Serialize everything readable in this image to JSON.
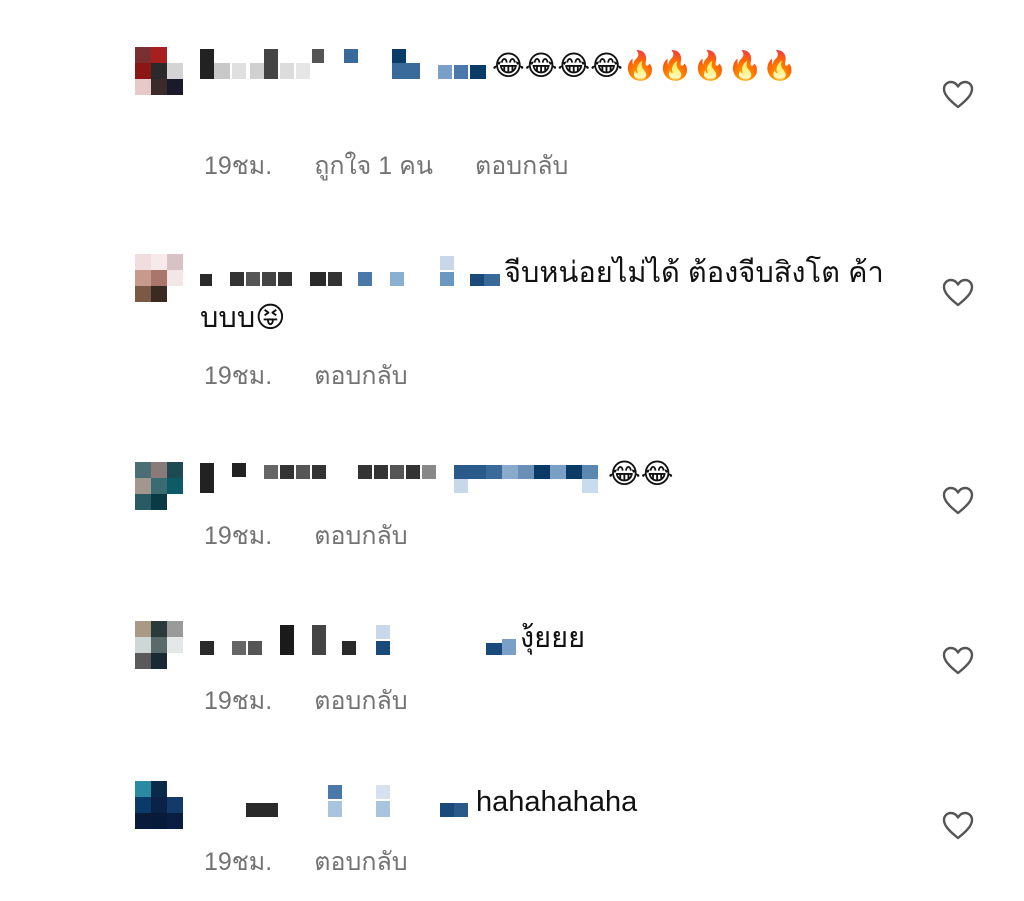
{
  "comments": [
    {
      "text": "😂😂😂😂🔥🔥🔥🔥🔥",
      "time": "19ชม.",
      "likes": "ถูกใจ 1 คน",
      "reply": "ตอบกลับ",
      "avatar_colors": [
        "#7a3030",
        "#a81f1f",
        "#ffffff",
        "#8c1616",
        "#2a2a2a",
        "#d4d4d4",
        "#e8c9c9",
        "#3a2a2a",
        "#1a1a2a"
      ]
    },
    {
      "text": "จีบหน่อยไม่ได้ ต้องจีบสิงโต ค้าบบบ😝",
      "time": "19ชม.",
      "reply": "ตอบกลับ",
      "avatar_colors": [
        "#f0dede",
        "#f6eaea",
        "#d9c2c6",
        "#c89a8e",
        "#a8766a",
        "#f3e6e6",
        "#7a5a44",
        "#3a2a22",
        "#ffffff"
      ]
    },
    {
      "text": "😂😂",
      "time": "19ชม.",
      "reply": "ตอบกลับ",
      "avatar_colors": [
        "#4a6e74",
        "#8a7a78",
        "#1e4a52",
        "#a2968f",
        "#3a6a72",
        "#0e5a66",
        "#2a5a62",
        "#0a3a44",
        "#ffffff"
      ]
    },
    {
      "text": "งุ้ยยย",
      "time": "19ชม.",
      "reply": "ตอบกลับ",
      "avatar_colors": [
        "#a89a84",
        "#2a3a3a",
        "#9a9a9a",
        "#cfd6d6",
        "#5a6a6a",
        "#e4e8e8",
        "#5a5a5a",
        "#1a2a34",
        "#ffffff"
      ]
    },
    {
      "text": "hahahahaha",
      "time": "19ชม.",
      "reply": "ตอบกลับ",
      "avatar_colors": [
        "#2a8aa2",
        "#0a2a4a",
        "#ffffff",
        "#0a3a6a",
        "#0a2246",
        "#143a6a",
        "#0a1a3a",
        "#061a3a",
        "#0a1e44"
      ]
    }
  ],
  "icons": {
    "like": "heart-outline-icon"
  }
}
